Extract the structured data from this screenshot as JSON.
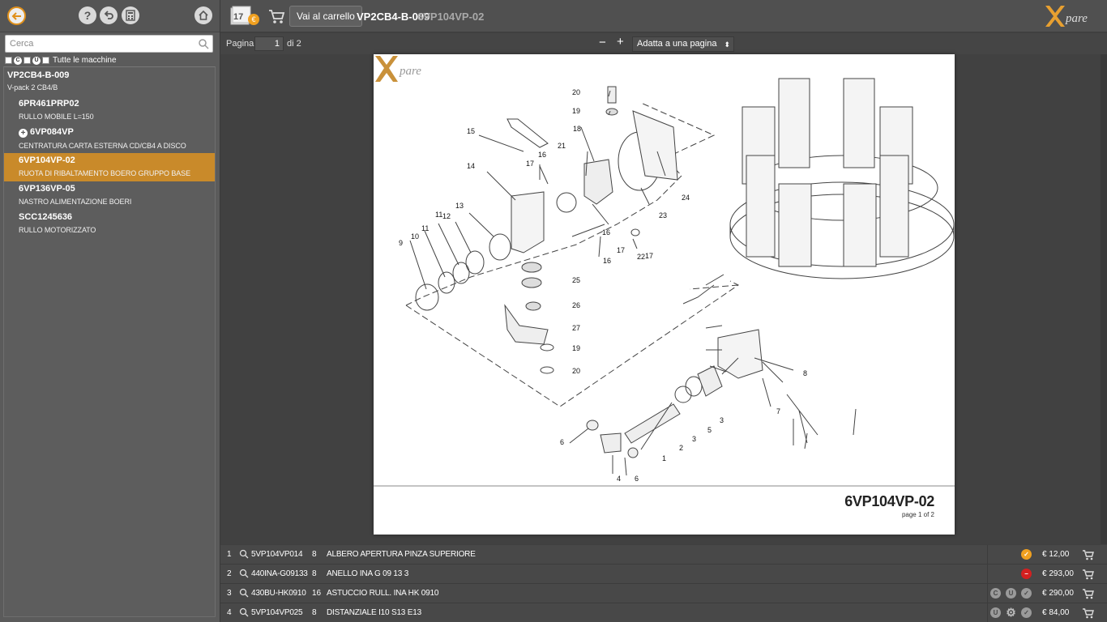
{
  "sidebar": {
    "search_placeholder": "Cerca",
    "filter_icons": [
      "C",
      "U"
    ],
    "filter_label": "Tutte le macchine",
    "root": {
      "code": "VP2CB4-B-009",
      "desc": "V-pack 2 CB4/B"
    },
    "items": [
      {
        "code": "6PR461PRP02",
        "desc": "RULLO MOBILE L=150",
        "selected": false,
        "expandable": false
      },
      {
        "code": "6VP084VP",
        "desc": "CENTRATURA CARTA ESTERNA CD/CB4 A DISCO",
        "selected": false,
        "expandable": true
      },
      {
        "code": "6VP104VP-02",
        "desc": "RUOTA DI RIBALTAMENTO BOERO GRUPPO BASE",
        "selected": true,
        "expandable": false
      },
      {
        "code": "6VP136VP-05",
        "desc": "NASTRO ALIMENTAZIONE BOERI",
        "selected": false,
        "expandable": false
      },
      {
        "code": "SCC1245636",
        "desc": "RULLO MOTORIZZATO",
        "selected": false,
        "expandable": false
      }
    ]
  },
  "topbar": {
    "counter": "17",
    "go_cart_label": "Vai al carrello",
    "title_code": "VP2CB4-B-009",
    "title_sub": "6VP104VP-02",
    "logo_text": "XPARE"
  },
  "pagebar": {
    "page_label": "Pagina:",
    "page_value": "1",
    "page_of": "di 2",
    "zoom_out": "−",
    "zoom_in": "+",
    "zoom_option": "Adatta a una pagina"
  },
  "sheet": {
    "code": "6VP104VP-02",
    "page_text": "page 1 of 2",
    "callouts": [
      "1",
      "2",
      "3",
      "3",
      "4",
      "5",
      "6",
      "6",
      "7",
      "8",
      "9",
      "10",
      "11",
      "11",
      "12",
      "13",
      "14",
      "15",
      "16",
      "16",
      "17",
      "17",
      "18",
      "19",
      "19",
      "20",
      "20",
      "21",
      "22",
      "23",
      "24",
      "25",
      "26",
      "27"
    ]
  },
  "parts": [
    {
      "idx": "1",
      "code": "5VP104VP014",
      "qty": "8",
      "desc": "ALBERO APERTURA PINZA SUPERIORE",
      "price": "€ 12,00",
      "status": [
        "ok"
      ]
    },
    {
      "idx": "2",
      "code": "440INA-G09133",
      "qty": "8",
      "desc": "ANELLO INA G 09 13 3",
      "price": "€ 293,00",
      "status": [
        "no"
      ]
    },
    {
      "idx": "3",
      "code": "430BU-HK0910",
      "qty": "16",
      "desc": "ASTUCCIO RULL. INA HK 0910",
      "price": "€ 290,00",
      "status": [
        "C",
        "U",
        "check"
      ]
    },
    {
      "idx": "4",
      "code": "5VP104VP025",
      "qty": "8",
      "desc": "DISTANZIALE I10 S13 E13",
      "price": "€ 84,00",
      "status": [
        "U",
        "gear",
        "check"
      ]
    }
  ],
  "colors": {
    "accent": "#c98a2a",
    "ok": "#f0a020",
    "error": "#d42020",
    "muted_icon": "#9a9a9a"
  }
}
